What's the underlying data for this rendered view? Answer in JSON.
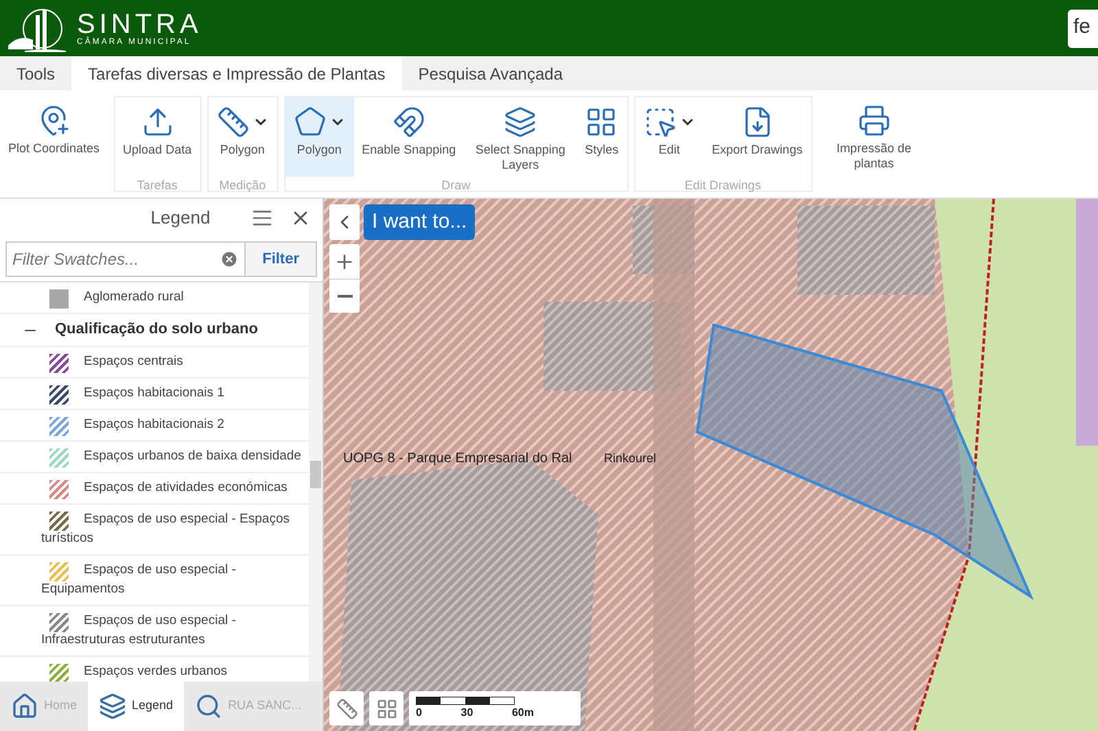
{
  "header": {
    "logo_title": "SINTRA",
    "logo_subtitle": "CÂMARA MUNICIPAL",
    "search_value": "fe"
  },
  "tabs": [
    {
      "label": "Tools",
      "selected": false
    },
    {
      "label": "Tarefas diversas e Impressão de Plantas",
      "selected": true
    },
    {
      "label": "Pesquisa Avançada",
      "selected": false
    }
  ],
  "ribbon": {
    "groups": [
      {
        "tools": [
          {
            "label": "Plot Coordinates",
            "dropdown": false,
            "selected": false
          }
        ]
      },
      {
        "label": "Tarefas",
        "tools": [
          {
            "label": "Upload Data",
            "dropdown": false,
            "selected": false
          }
        ]
      },
      {
        "label": "Medição",
        "tools": [
          {
            "label": "Polygon",
            "dropdown": true,
            "selected": false
          }
        ]
      },
      {
        "label": "Draw",
        "tools": [
          {
            "label": "Polygon",
            "dropdown": true,
            "selected": true
          },
          {
            "label": "Enable Snapping",
            "dropdown": false,
            "selected": false
          },
          {
            "label": "Select Snapping Layers",
            "dropdown": false,
            "selected": false
          },
          {
            "label": "Styles",
            "dropdown": false,
            "selected": false
          }
        ]
      },
      {
        "label": "Edit Drawings",
        "tools": [
          {
            "label": "Edit",
            "dropdown": true,
            "selected": false
          },
          {
            "label": "Export Drawings",
            "dropdown": false,
            "selected": false
          }
        ]
      },
      {
        "tools": [
          {
            "label": "Impressão de plantas",
            "dropdown": false,
            "selected": false
          }
        ]
      }
    ]
  },
  "legend": {
    "title": "Legend",
    "filter_placeholder": "Filter Swatches...",
    "filter_button": "Filter",
    "items": [
      {
        "kind": "solid",
        "label": "Aglomerado rural",
        "color": "#a8a8a8"
      },
      {
        "kind": "group",
        "label": "Qualificação do solo urbano",
        "expanded": true,
        "children": [
          {
            "kind": "hatched",
            "label": "Espaços centrais",
            "color": "#8a4a9a"
          },
          {
            "kind": "hatched",
            "label": "Espaços habitacionais 1",
            "color": "#3a4a6a"
          },
          {
            "kind": "hatched",
            "label": "Espaços habitacionais 2",
            "color": "#7aa8d8"
          },
          {
            "kind": "hatched",
            "label": "Espaços urbanos de baixa densidade",
            "color": "#9fd8c0"
          },
          {
            "kind": "hatched",
            "label": "Espaços de atividades económicas",
            "color": "#d88a8a"
          },
          {
            "kind": "hatched",
            "label": "Espaços de uso especial - Espaços turísticos",
            "color": "#7a6a4a"
          },
          {
            "kind": "hatched",
            "label": "Espaços de uso especial - Equipamentos",
            "color": "#e8c050"
          },
          {
            "kind": "hatched",
            "label": "Espaços de uso especial - Infraestruturas estruturantes",
            "color": "#888888"
          },
          {
            "kind": "hatched",
            "label": "Espaços verdes urbanos",
            "color": "#8ab040"
          }
        ]
      }
    ]
  },
  "bottom_tabs": [
    {
      "label": "Home",
      "selected": false
    },
    {
      "label": "Legend",
      "selected": true
    },
    {
      "label": "RUA SANC...",
      "selected": false
    }
  ],
  "map": {
    "i_want_to": "I want to...",
    "labels": [
      "UOPG 8 - Parque Empresarial do Ral",
      "Rinkourel"
    ],
    "scale_labels": [
      "0",
      "30",
      "60m"
    ]
  }
}
